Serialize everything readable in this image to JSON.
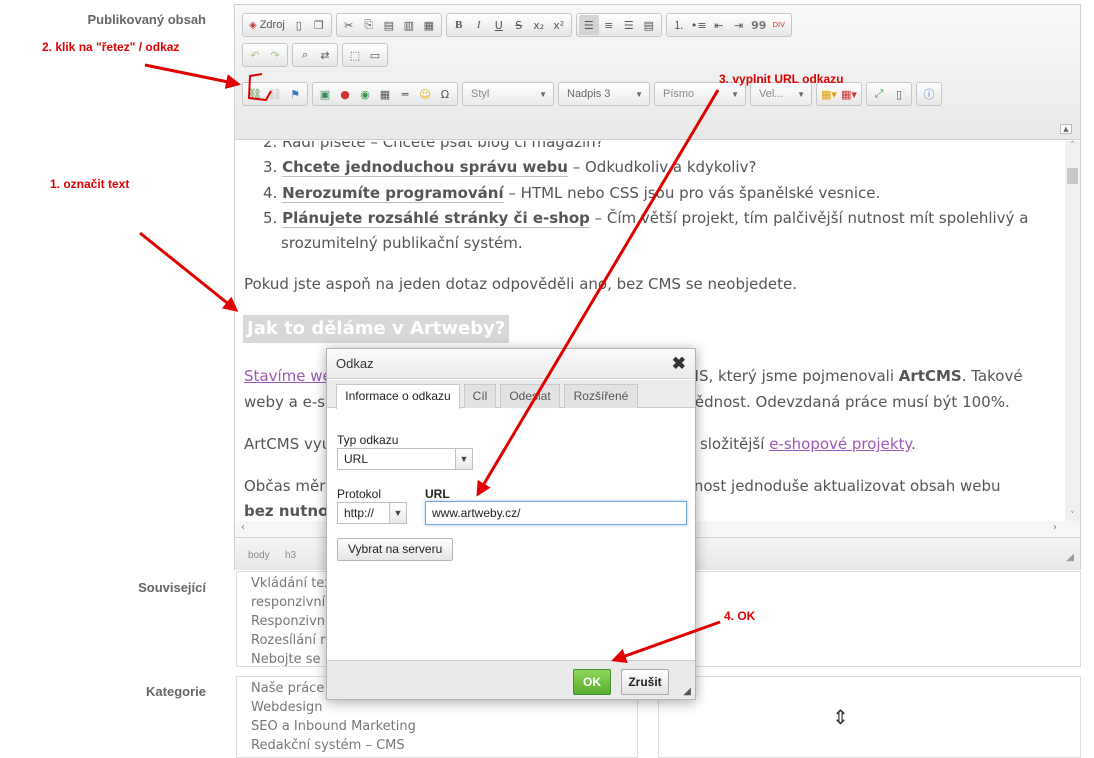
{
  "labels": {
    "published": "Publikovaný obsah",
    "related": "Související",
    "category": "Kategorie"
  },
  "toolbar": {
    "source": "Zdroj",
    "bold": "B",
    "italic": "I",
    "underline": "U",
    "strike": "S",
    "subscript": "x₂",
    "superscript": "x²",
    "quote": "99",
    "div": "DIV",
    "omega": "Ω",
    "style_combo": "Styl",
    "format_combo": "Nadpis 3",
    "font_combo": "Písmo",
    "size_combo": "Vel...",
    "collapse": "▲"
  },
  "content": {
    "item2": "2. Rádi píšete – Chcete psát blog či magazín?",
    "item3_num": "3.",
    "item3_bold": "Chcete jednoduchou správu webu",
    "item3_rest": " – Odkudkoliv a kdykoliv?",
    "item4_num": "4.",
    "item4_bold": "Nerozumíte programování",
    "item4_rest": " – HTML nebo CSS jsou pro vás španělské vesnice.",
    "item5_num": "5.",
    "item5_bold": "Plánujete rozsáhlé stránky či e-shop",
    "item5_rest": " – Čím větší projekt, tím palčivější nutnost mít spolehlivý a",
    "item5_cont": "srozumitelný publikační systém.",
    "para1": "Pokud jste aspoň na jeden dotaz odpověděli ano, bez CMS se neobjedete.",
    "heading": "Jak to děláme v Artweby?",
    "para2_link": "Stavíme we",
    "para2_rest": "MS, který jsme pojmenovali",
    "para2_bold": "ArtCMS",
    "para2_end": ". Takové",
    "para3_start": "weby a e-s",
    "para3_rest": "vědnost. Odevzdaná práce musí být 100%.",
    "para4_start": "ArtCMS vyu",
    "para4_rest": "o složitější",
    "para4_link": "e-shopové projekty",
    "para4_end": ".",
    "para5_start": "Občas měr",
    "para5_rest": "žnost jednoduše aktualizovat obsah webu",
    "para6_bold": "bez nutno"
  },
  "pathbar": {
    "body": "body",
    "h3": "h3"
  },
  "related_items": [
    "Vkládání tex",
    "responzivní",
    "Responzivn",
    "Rozesílání r",
    "Nebojte se"
  ],
  "category_items": [
    "Naše práce",
    "Webdesign",
    "SEO a Inbound Marketing",
    "Redakční systém – CMS"
  ],
  "dialog": {
    "title": "Odkaz",
    "close": "✖",
    "tabs": [
      "Informace o odkazu",
      "Cíl",
      "Odeslat",
      "Rozšířené"
    ],
    "link_type_label": "Typ odkazu",
    "link_type_value": "URL",
    "protocol_label": "Protokol",
    "protocol_value": "http://",
    "url_label": "URL",
    "url_value": "www.artweby.cz/",
    "browse_server": "Vybrat na serveru",
    "ok": "OK",
    "cancel": "Zrušit"
  },
  "annotations": {
    "step1": "1. označit text",
    "step2": "2. klik na \"řetez\" / odkaz",
    "step3": "3. vyplnit URL odkazu",
    "step4": "4. OK"
  },
  "colors": {
    "annotation": "#e00000",
    "ok_button": "#5cb030",
    "link": "#9b59b6"
  }
}
